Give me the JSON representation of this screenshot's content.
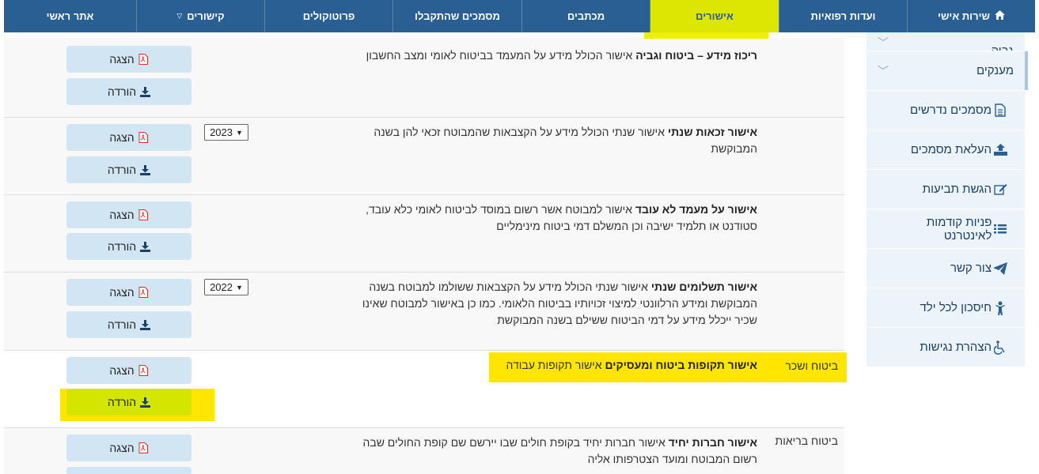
{
  "nav": {
    "items": [
      {
        "label": "שירות אישי",
        "icon": "home-icon",
        "active": false
      },
      {
        "label": "ועדות רפואיות",
        "active": false
      },
      {
        "label": "אישורים",
        "active": true
      },
      {
        "label": "מכתבים",
        "active": false
      },
      {
        "label": "מסמכים שהתקבלו",
        "active": false
      },
      {
        "label": "פרוטוקולים",
        "active": false
      },
      {
        "label": "קישורים",
        "has_dropdown": true,
        "active": false
      },
      {
        "label": "אתר ראשי",
        "active": false
      }
    ]
  },
  "sidebar": {
    "items": [
      {
        "label": "גביה",
        "icon": "chevron-down-icon"
      },
      {
        "label": "מענקים",
        "icon": "chevron-down-icon"
      },
      {
        "label": "מסמכים נדרשים",
        "icon": "document-icon"
      },
      {
        "label": "העלאת מסמכים",
        "icon": "upload-icon"
      },
      {
        "label": "הגשת תביעות",
        "icon": "edit-icon"
      },
      {
        "label": "פניות קודמות לאינטרנט",
        "icon": "list-icon"
      },
      {
        "label": "צור קשר",
        "icon": "paper-plane-icon"
      },
      {
        "label": "חיסכון לכל ילד",
        "icon": "child-icon"
      },
      {
        "label": "הצהרת נגישות",
        "icon": "wheelchair-icon"
      }
    ]
  },
  "buttons": {
    "view": "הצגה",
    "download": "הורדה"
  },
  "rows": [
    {
      "category": "",
      "title": "ריכוז מידע – ביטוח וגביה",
      "text": " אישור הכולל מידע על המעמד בביטוח לאומי ומצב החשבון",
      "year": ""
    },
    {
      "category": "",
      "title": "אישור זכאות שנתי",
      "text": " אישור שנתי הכולל מידע על הקצבאות שהמבוטח זכאי להן בשנה המבוקשת",
      "year": "2023"
    },
    {
      "category": "",
      "title": "אישור על מעמד לא עובד",
      "text": " אישור למבוטח אשר רשום במוסד לביטוח לאומי כלא עובד, סטודנט או תלמיד ישיבה וכן המשלם דמי ביטוח מינימליים",
      "year": ""
    },
    {
      "category": "",
      "title": "אישור תשלומים שנתי",
      "text": " אישור שנתי הכולל מידע על הקצבאות ששולמו למבוטח בשנה המבוקשת ומידע הרלוונטי למיצוי זכויותיו בביטוח הלאומי. כמו כן באישור למבוטח שאינו שכיר ייכלל מידע על דמי הביטוח ששילם בשנה המבוקשת",
      "year": "2022"
    },
    {
      "category": "ביטוח ושכר",
      "title": "אישור תקופות ביטוח ומעסיקים",
      "text": " אישור תקופות עבודה",
      "year": ""
    },
    {
      "category": "ביטוח בריאות",
      "title": "אישור חברות יחיד",
      "text": " אישור חברות יחיד בקופת חולים שבו יירשם שם קופת החולים שבה רשום המבוטח ומועד הצטרפותו אליה",
      "year": ""
    }
  ],
  "colors": {
    "nav_bg": "#2a5f93",
    "nav_active": "#dde600",
    "highlight": "#ffe600",
    "button_bg": "#d1e6f2",
    "sidebar_bg": "#ecf4fa"
  }
}
